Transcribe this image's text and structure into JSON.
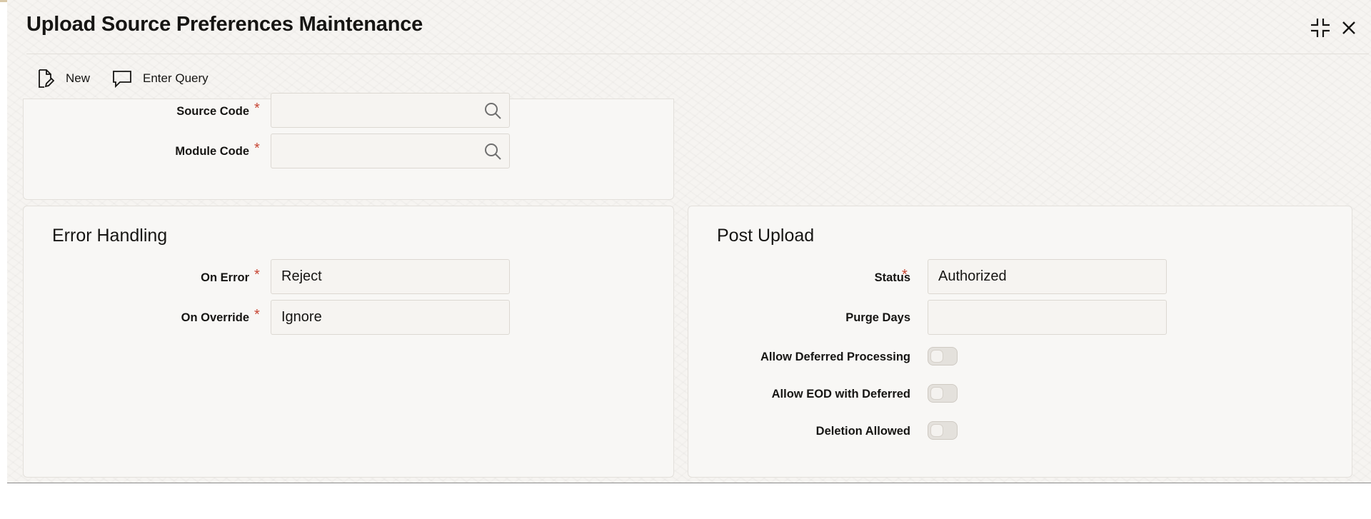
{
  "window": {
    "title": "Upload Source Preferences Maintenance",
    "controls": {
      "minimize_icon": "collapse-icon",
      "close_icon": "close-icon"
    }
  },
  "toolbar": {
    "new_label": "New",
    "enter_query_label": "Enter Query"
  },
  "header_section": {
    "source_code": {
      "label": "Source Code",
      "value": "",
      "required": true
    },
    "module_code": {
      "label": "Module Code",
      "value": "",
      "required": true
    }
  },
  "error_handling": {
    "title": "Error Handling",
    "on_error": {
      "label": "On Error",
      "value": "Reject",
      "required": true
    },
    "on_override": {
      "label": "On Override",
      "value": "Ignore",
      "required": true
    }
  },
  "post_upload": {
    "title": "Post Upload",
    "status": {
      "label": "Status",
      "value": "Authorized",
      "required": true
    },
    "purge_days": {
      "label": "Purge Days",
      "value": ""
    },
    "allow_deferred_processing": {
      "label": "Allow Deferred Processing",
      "value": false
    },
    "allow_eod_with_deferred": {
      "label": "Allow EOD with Deferred",
      "value": false
    },
    "deletion_allowed": {
      "label": "Deletion Allowed",
      "value": false
    }
  },
  "colors": {
    "required_marker": "#c74634",
    "background": "#f6f4f1",
    "panel": "#f8f7f5",
    "text": "#161513"
  }
}
